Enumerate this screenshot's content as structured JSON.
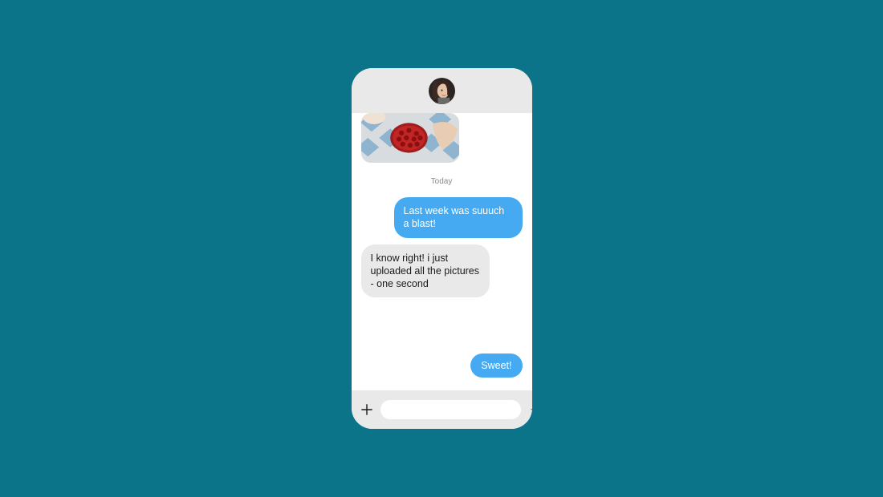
{
  "colors": {
    "page_bg": "#0c7489",
    "device_bg": "#ffffff",
    "header_bg": "#e9e9e9",
    "composer_bg": "#e9e9e9",
    "outgoing_bubble": "#45aaf2",
    "outgoing_text": "#ffffff",
    "incoming_bubble": "#e9e9e9",
    "incoming_text": "#1a1a1a",
    "timestamp_text": "#8a8a8a"
  },
  "header": {
    "avatar_alt": "contact avatar"
  },
  "thread": {
    "attachment_alt": "photo attachment",
    "timestamp": "Today",
    "messages": [
      {
        "side": "out",
        "text": "Last week was suuuch a blast!"
      },
      {
        "side": "in",
        "text": "I know right! i just uploaded all the pictures - one second"
      },
      {
        "side": "out",
        "text": "Sweet!"
      }
    ]
  },
  "composer": {
    "plus_label": "add attachment",
    "input_placeholder": "",
    "input_value": "",
    "send_label": "send"
  }
}
